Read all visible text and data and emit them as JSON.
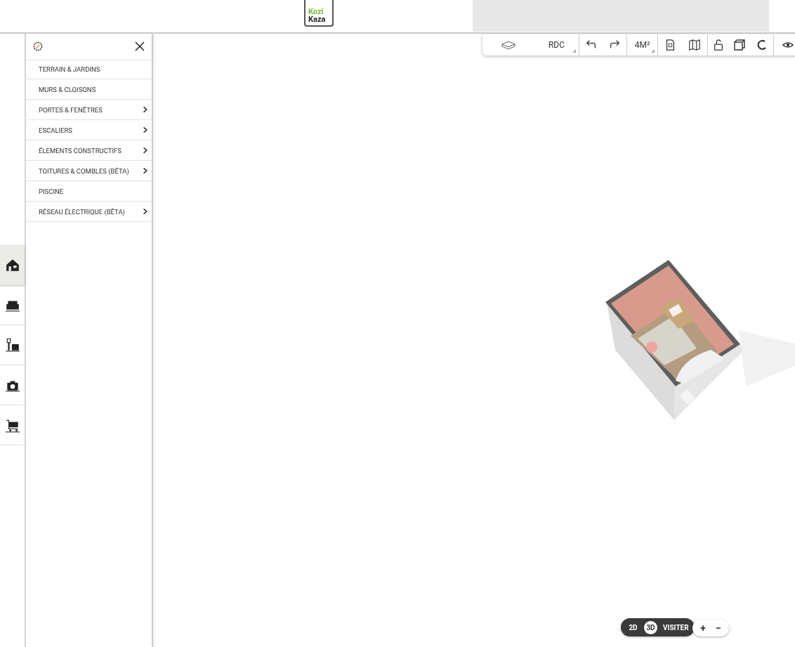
{
  "header": {
    "logo": {
      "top": "Kozi",
      "bottom": "Kaza"
    }
  },
  "rail": {
    "items": [
      {
        "selected": true
      },
      {
        "selected": false
      },
      {
        "selected": false
      },
      {
        "selected": false
      },
      {
        "selected": false
      }
    ]
  },
  "panel": {
    "items": [
      {
        "label": "TERRAIN & JARDINS",
        "has_submenu": false
      },
      {
        "label": "MURS & CLOISONS",
        "has_submenu": false
      },
      {
        "label": "PORTES & FENÊTRES",
        "has_submenu": true
      },
      {
        "label": "ESCALIERS",
        "has_submenu": true
      },
      {
        "label": "ÉLEMENTS CONSTRUCTIFS",
        "has_submenu": true
      },
      {
        "label": "TOITURES & COMBLES (BÊTA)",
        "has_submenu": true
      },
      {
        "label": "PISCINE",
        "has_submenu": false
      },
      {
        "label": "RÉSEAU ÉLECTRIQUE (BÊTA)",
        "has_submenu": true
      }
    ]
  },
  "toolbar": {
    "level": "RDC",
    "area": "4M²"
  },
  "view": {
    "modes": [
      {
        "label": "2D",
        "selected": false
      },
      {
        "label": "3D",
        "selected": true
      }
    ],
    "visit": "VISITER"
  },
  "zoom": {
    "plus": "+",
    "minus": "−"
  }
}
